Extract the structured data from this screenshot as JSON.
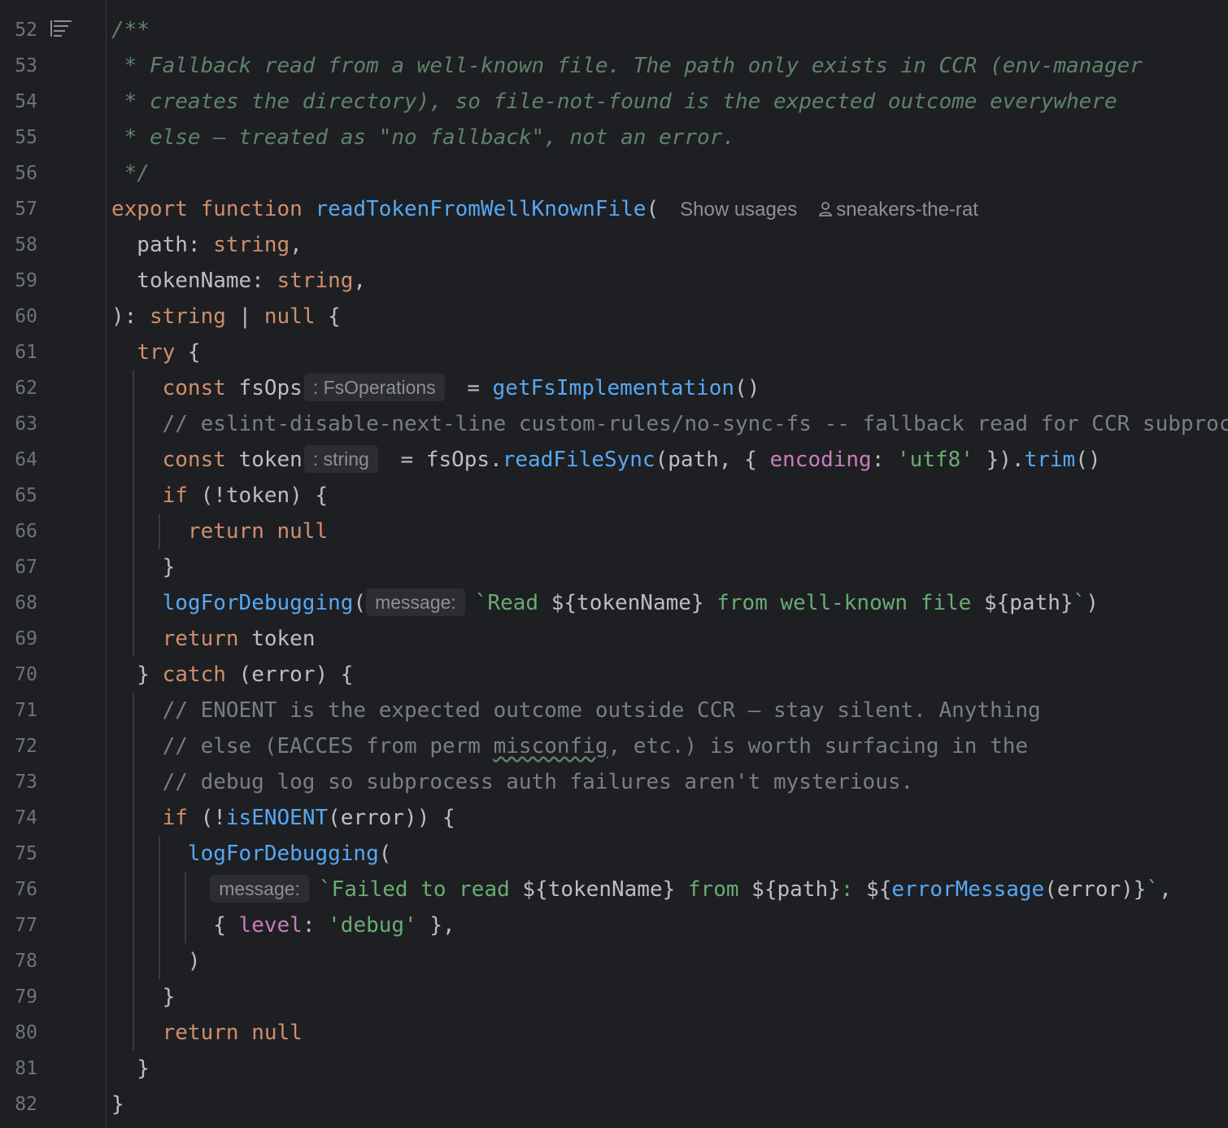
{
  "editor": {
    "author_lens": "sneakers-the-rat",
    "usages_lens": "Show usages",
    "hints": {
      "fs_ops_type": ": FsOperations",
      "token_type": ": string",
      "message_param": "message:"
    },
    "lines": [
      {
        "n": "52"
      },
      {
        "n": "53"
      },
      {
        "n": "54"
      },
      {
        "n": "55"
      },
      {
        "n": "56"
      },
      {
        "n": "57"
      },
      {
        "n": "58"
      },
      {
        "n": "59"
      },
      {
        "n": "60"
      },
      {
        "n": "61"
      },
      {
        "n": "62"
      },
      {
        "n": "63"
      },
      {
        "n": "64"
      },
      {
        "n": "65"
      },
      {
        "n": "66"
      },
      {
        "n": "67"
      },
      {
        "n": "68"
      },
      {
        "n": "69"
      },
      {
        "n": "70"
      },
      {
        "n": "71"
      },
      {
        "n": "72"
      },
      {
        "n": "73"
      },
      {
        "n": "74"
      },
      {
        "n": "75"
      },
      {
        "n": "76"
      },
      {
        "n": "77"
      },
      {
        "n": "78"
      },
      {
        "n": "79"
      },
      {
        "n": "80"
      },
      {
        "n": "81"
      },
      {
        "n": "82"
      }
    ],
    "code": {
      "l52": "/**",
      "l53": " * Fallback read from a well-known file. The path only exists in CCR (env-manager",
      "l54": " * creates the directory), so file-not-found is the expected outcome everywhere",
      "l55": " * else — treated as \"no fallback\", not an error.",
      "l56": " */",
      "l57_kw": "export function ",
      "l57_fn": "readTokenFromWellKnownFile",
      "l57_tail": "(",
      "l58_a": "  path: ",
      "l58_b": "string",
      "l58_c": ",",
      "l59_a": "  tokenName: ",
      "l59_b": "string",
      "l59_c": ",",
      "l60_a": "): ",
      "l60_b": "string",
      "l60_c": " | ",
      "l60_d": "null",
      "l60_e": " {",
      "l61_a": "  ",
      "l61_b": "try",
      "l61_c": " {",
      "l62_a": "    ",
      "l62_b": "const",
      "l62_c": " fsOps",
      "l62_d": " = ",
      "l62_e": "getFsImplementation",
      "l62_f": "()",
      "l63": "    // eslint-disable-next-line custom-rules/no-sync-fs -- fallback read for CCR subproc",
      "l64_a": "    ",
      "l64_b": "const",
      "l64_c": " token",
      "l64_d": " = fsOps.",
      "l64_e": "readFileSync",
      "l64_f": "(path, { ",
      "l64_g": "encoding",
      "l64_h": ": ",
      "l64_i": "'utf8'",
      "l64_j": " }).",
      "l64_k": "trim",
      "l64_l": "()",
      "l65_a": "    ",
      "l65_b": "if",
      "l65_c": " (!token) {",
      "l66_a": "      ",
      "l66_b": "return null",
      "l67": "    }",
      "l68_a": "    ",
      "l68_b": "logForDebugging",
      "l68_c": "(",
      "l68_d": "`Read ",
      "l68_e": "${tokenName}",
      "l68_f": " from well-known file ",
      "l68_g": "${path}",
      "l68_h": "`",
      "l68_i": ")",
      "l69_a": "    ",
      "l69_b": "return",
      "l69_c": " token",
      "l70_a": "  } ",
      "l70_b": "catch",
      "l70_c": " (error) {",
      "l71": "    // ENOENT is the expected outcome outside CCR — stay silent. Anything",
      "l72_a": "    // else (EACCES from perm ",
      "l72_b": "misconfig",
      "l72_c": ", etc.) is worth surfacing in the",
      "l73": "    // debug log so subprocess auth failures aren't mysterious.",
      "l74_a": "    ",
      "l74_b": "if",
      "l74_c": " (!",
      "l74_d": "isENOENT",
      "l74_e": "(error)) {",
      "l75_a": "      ",
      "l75_b": "logForDebugging",
      "l75_c": "(",
      "l76_a": "        ",
      "l76_b": "`Failed to read ",
      "l76_c": "${tokenName}",
      "l76_d": " from ",
      "l76_e": "${path}",
      "l76_f": ": ",
      "l76_g": "${",
      "l76_h": "errorMessage",
      "l76_i": "(error)}",
      "l76_j": "`",
      "l76_k": ",",
      "l77_a": "        { ",
      "l77_b": "level",
      "l77_c": ": ",
      "l77_d": "'debug'",
      "l77_e": " },",
      "l78": "      )",
      "l79": "    }",
      "l80_a": "    ",
      "l80_b": "return null",
      "l81": "  }",
      "l82": "}"
    }
  }
}
